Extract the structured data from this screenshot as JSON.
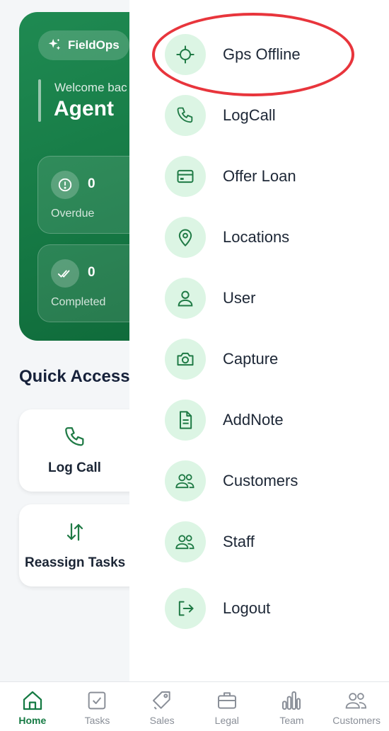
{
  "colors": {
    "brand_green": "#167a45",
    "icon_green": "#1f7a45",
    "icon_bg": "#dcf5e4",
    "highlight": "#e8353c",
    "nav_inactive": "#8a8f98"
  },
  "header": {
    "brand": "FieldOps",
    "welcome": "Welcome bac",
    "agent": "Agent"
  },
  "stats": {
    "overdue": {
      "value": "0",
      "label": "Overdue",
      "icon": "alert-circle-icon"
    },
    "completed": {
      "value": "0",
      "label": "Completed",
      "icon": "double-check-icon"
    }
  },
  "quick_access": {
    "title": "Quick Access",
    "items": [
      {
        "label": "Log Call",
        "icon": "phone-icon"
      },
      {
        "label": "Reassign Tasks",
        "icon": "swap-vertical-icon"
      }
    ]
  },
  "drawer": {
    "items": [
      {
        "label": "Gps Offline",
        "icon": "crosshair-icon"
      },
      {
        "label": "LogCall",
        "icon": "phone-icon"
      },
      {
        "label": "Offer Loan",
        "icon": "credit-card-icon"
      },
      {
        "label": "Locations",
        "icon": "map-pin-icon"
      },
      {
        "label": "User",
        "icon": "user-icon"
      },
      {
        "label": "Capture",
        "icon": "camera-icon"
      },
      {
        "label": "AddNote",
        "icon": "note-icon"
      },
      {
        "label": "Customers",
        "icon": "users-icon"
      },
      {
        "label": "Staff",
        "icon": "users-icon"
      },
      {
        "label": "Logout",
        "icon": "logout-icon"
      }
    ]
  },
  "bottom_nav": {
    "active": "Home",
    "items": [
      {
        "label": "Home",
        "icon": "home-icon"
      },
      {
        "label": "Tasks",
        "icon": "checkbox-icon"
      },
      {
        "label": "Sales",
        "icon": "tag-icon"
      },
      {
        "label": "Legal",
        "icon": "briefcase-icon"
      },
      {
        "label": "Team",
        "icon": "bar-chart-icon"
      },
      {
        "label": "Customers",
        "icon": "users-icon"
      }
    ]
  }
}
